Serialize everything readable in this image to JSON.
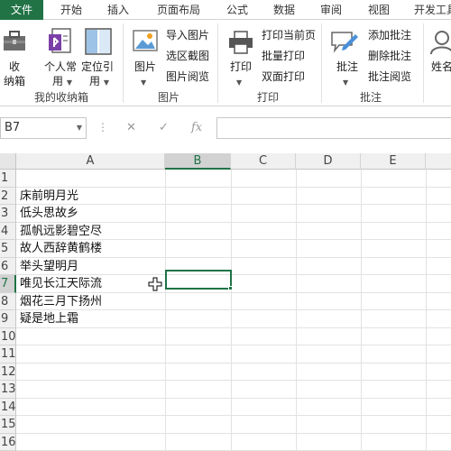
{
  "tabs": [
    "文件",
    "开始",
    "插入",
    "页面布局",
    "公式",
    "数据",
    "审阅",
    "视图",
    "开发工具"
  ],
  "ribbon": {
    "favorites_group": {
      "label": "我的收纳箱",
      "collect_btn": [
        "收",
        "纳箱"
      ],
      "personal_btn": [
        "个人常",
        "用"
      ],
      "locate_btn": [
        "定位引",
        "用"
      ]
    },
    "picture_group": {
      "label": "图片",
      "picture_btn": "图片",
      "items": [
        "导入图片",
        "选区截图",
        "图片阅览"
      ]
    },
    "print_group": {
      "label": "打印",
      "print_btn": "打印",
      "items": [
        "打印当前页",
        "批量打印",
        "双面打印"
      ]
    },
    "comment_group": {
      "label": "批注",
      "comment_btn": "批注",
      "items": [
        "添加批注",
        "删除批注",
        "批注阅览"
      ]
    },
    "name_btn": "姓名"
  },
  "formula_bar": {
    "name_box": "B7",
    "fx": "fx",
    "cancel": "✕",
    "enter": "✓",
    "dots": "⋮",
    "formula": ""
  },
  "grid": {
    "columns": [
      "A",
      "B",
      "C",
      "D",
      "E"
    ],
    "active_column": "B",
    "active_row": 7,
    "rows": [
      "1",
      "2",
      "3",
      "4",
      "5",
      "6",
      "7",
      "8",
      "9",
      "10",
      "11",
      "12",
      "13",
      "14",
      "15",
      "16"
    ],
    "cells_a": [
      "",
      "床前明月光",
      "低头思故乡",
      "孤帆远影碧空尽",
      "故人西辞黄鹤楼",
      "举头望明月",
      "唯见长江天际流",
      "烟花三月下扬州",
      "疑是地上霜",
      "",
      "",
      "",
      "",
      "",
      "",
      ""
    ]
  },
  "colors": {
    "accent": "#217346",
    "header_bg": "#f0f0f0",
    "gridline": "#e2e2e2"
  }
}
